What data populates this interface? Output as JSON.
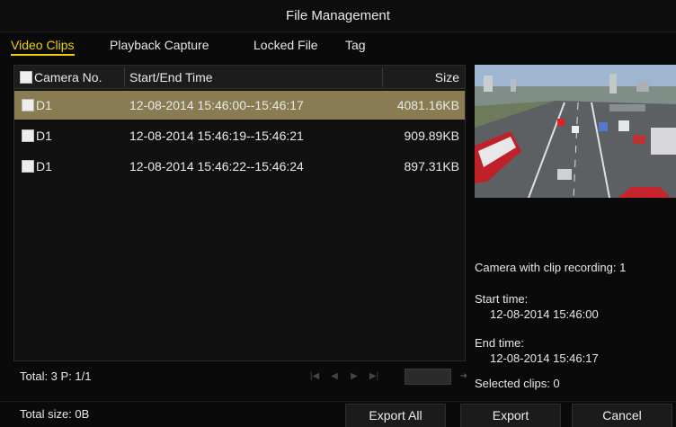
{
  "window": {
    "title": "File Management"
  },
  "tabs": [
    {
      "label": "Video Clips",
      "active": true
    },
    {
      "label": "Playback Capture",
      "active": false
    },
    {
      "label": "Locked File",
      "active": false
    },
    {
      "label": "Tag",
      "active": false
    }
  ],
  "table": {
    "headers": {
      "camera": "Camera No.",
      "time": "Start/End Time",
      "size": "Size"
    },
    "rows": [
      {
        "camera": "D1",
        "time": "12-08-2014 15:46:00--15:46:17",
        "size": "4081.16KB",
        "selected": true
      },
      {
        "camera": "D1",
        "time": "12-08-2014 15:46:19--15:46:21",
        "size": "909.89KB",
        "selected": false
      },
      {
        "camera": "D1",
        "time": "12-08-2014 15:46:22--15:46:24",
        "size": "897.31KB",
        "selected": false
      }
    ]
  },
  "footer": {
    "total": "Total: 3  P: 1/1"
  },
  "pager": {
    "icons": [
      "first-page-icon",
      "prev-page-icon",
      "next-page-icon",
      "last-page-icon",
      "go-arrow-icon"
    ]
  },
  "info": {
    "camera_recording": "Camera with clip recording: 1",
    "start_label": "Start time:",
    "start_value": "12-08-2014 15:46:00",
    "end_label": "End time:",
    "end_value": "12-08-2014 15:46:17",
    "selected_clips": "Selected clips: 0"
  },
  "bottom": {
    "total_size": "Total size: 0B",
    "export_all": "Export All",
    "export": "Export",
    "cancel": "Cancel"
  },
  "colors": {
    "active_tab": "#f0d000",
    "selected_row": "#8a7c52",
    "background": "#0a0a0a"
  }
}
